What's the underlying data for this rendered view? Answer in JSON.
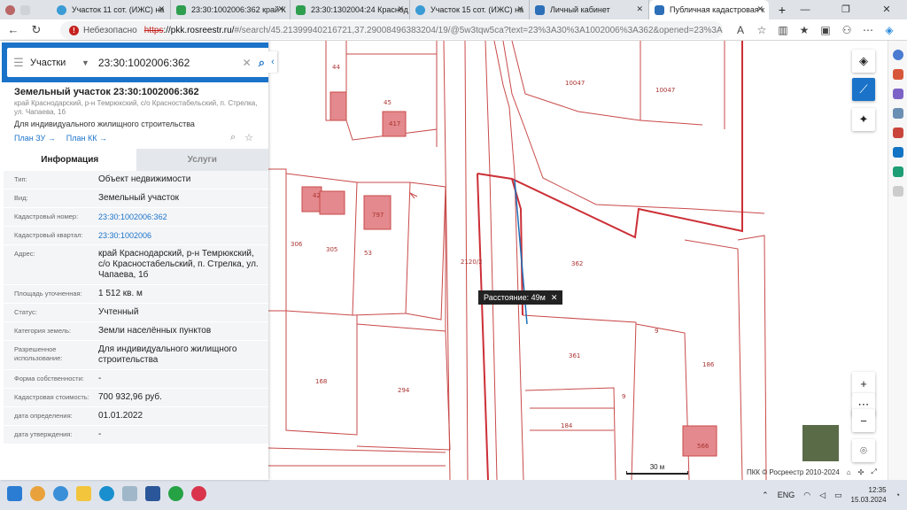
{
  "browser": {
    "tabs": [
      {
        "title": "Участок 11 сот. (ИЖС) на",
        "color": "#3a9bd5",
        "active": false
      },
      {
        "title": "23:30:1002006:362 край К",
        "color": "#2e9e4f",
        "active": false
      },
      {
        "title": "23:30:1302004:24 Краснод",
        "color": "#2e9e4f",
        "active": false
      },
      {
        "title": "Участок 15 сот. (ИЖС) на",
        "color": "#3a9bd5",
        "active": false
      },
      {
        "title": "Личный кабинет",
        "color": "#2d6fb8",
        "active": false
      },
      {
        "title": "Публичная кадастровая к",
        "color": "#2d6fb8",
        "active": true
      }
    ],
    "security_label": "Небезопасно",
    "url_scheme": "https",
    "url_host": "://pkk.rosreestr.ru/",
    "url_rest": "#/search/45.21399940216721,37.29008496383204/19/@5w3tqw5ca?text=23%3A30%3A1002006%3A362&opened=23%3A30..."
  },
  "search": {
    "type_label": "Участки",
    "query": "23:30:1002006:362"
  },
  "object": {
    "title": "Земельный участок 23:30:1002006:362",
    "address_short": "край Краснодарский, р-н Темрюкский, с/о Красностабельский, п. Стрелка, ул. Чапаева, 1б",
    "use": "Для индивидуального жилищного строительства",
    "link_zu": "План ЗУ",
    "link_kk": "План КК",
    "tab_info": "Информация",
    "tab_services": "Услуги",
    "properties": [
      {
        "key": "Тип:",
        "value": "Объект недвижимости",
        "link": false
      },
      {
        "key": "Вид:",
        "value": "Земельный участок",
        "link": false
      },
      {
        "key": "Кадастровый номер:",
        "value": "23:30:1002006:362",
        "link": true
      },
      {
        "key": "Кадастровый квартал:",
        "value": "23:30:1002006",
        "link": true
      },
      {
        "key": "Адрес:",
        "value": "край Краснодарский, р-н Темрюкский, с/о Красностабельский, п. Стрелка, ул. Чапаева, 1б",
        "link": false
      },
      {
        "key": "Площадь уточненная:",
        "value": "1 512 кв. м",
        "link": false
      },
      {
        "key": "Статус:",
        "value": "Учтенный",
        "link": false
      },
      {
        "key": "Категория земель:",
        "value": "Земли населённых пунктов",
        "link": false
      },
      {
        "key": "Разрешенное использование:",
        "value": "Для индивидуального жилищного строительства",
        "link": false
      },
      {
        "key": "Форма собственности:",
        "value": "-",
        "link": false
      },
      {
        "key": "Кадастровая стоимость:",
        "value": "700 932,96 руб.",
        "link": false
      },
      {
        "key": "дата определения:",
        "value": "01.01.2022",
        "link": false
      },
      {
        "key": "дата утверждения:",
        "value": "-",
        "link": false
      }
    ]
  },
  "map": {
    "parcel_labels": [
      "44",
      "45",
      "10047",
      "10047",
      "306",
      "305",
      "53",
      "2120/2",
      "362",
      "361",
      "9",
      "9",
      "186",
      "168",
      "294",
      "184",
      "566",
      "417",
      "797",
      "42"
    ],
    "distance_label": "Расстояние: 49м",
    "scale_label": "30 м",
    "copyright": "ПКК © Росреестр 2010-2024"
  },
  "taskbar": {
    "lang": "ENG",
    "time": "12:35",
    "date": "15.03.2024"
  }
}
